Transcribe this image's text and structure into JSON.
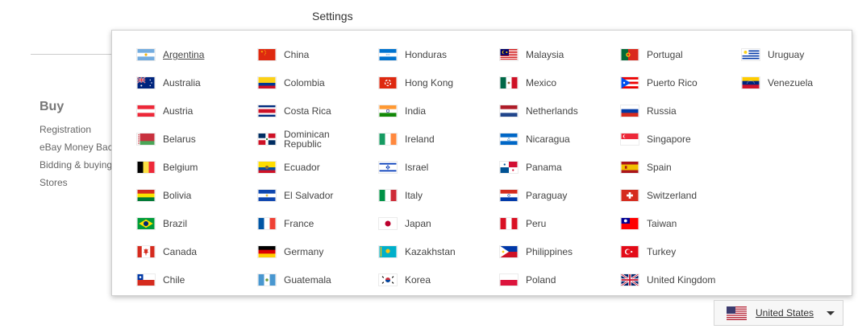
{
  "header": {
    "settings": "Settings"
  },
  "sidebar": {
    "title": "Buy",
    "links": [
      "Registration",
      "eBay Money Bac",
      "Bidding & buying",
      "Stores"
    ]
  },
  "countries": [
    [
      "Argentina",
      "Australia",
      "Austria",
      "Belarus",
      "Belgium",
      "Bolivia",
      "Brazil",
      "Canada",
      "Chile"
    ],
    [
      "China",
      "Colombia",
      "Costa Rica",
      "Dominican Republic",
      "Ecuador",
      "El Salvador",
      "France",
      "Germany",
      "Guatemala"
    ],
    [
      "Honduras",
      "Hong Kong",
      "India",
      "Ireland",
      "Israel",
      "Italy",
      "Japan",
      "Kazakhstan",
      "Korea"
    ],
    [
      "Malaysia",
      "Mexico",
      "Netherlands",
      "Nicaragua",
      "Panama",
      "Paraguay",
      "Peru",
      "Philippines",
      "Poland"
    ],
    [
      "Portugal",
      "Puerto Rico",
      "Russia",
      "Singapore",
      "Spain",
      "Switzerland",
      "Taiwan",
      "Turkey",
      "United Kingdom"
    ],
    [
      "Uruguay",
      "Venezuela"
    ]
  ],
  "hovered_country": "Argentina",
  "selected_country": {
    "label": "United States",
    "flag": "us-flag-icon"
  }
}
